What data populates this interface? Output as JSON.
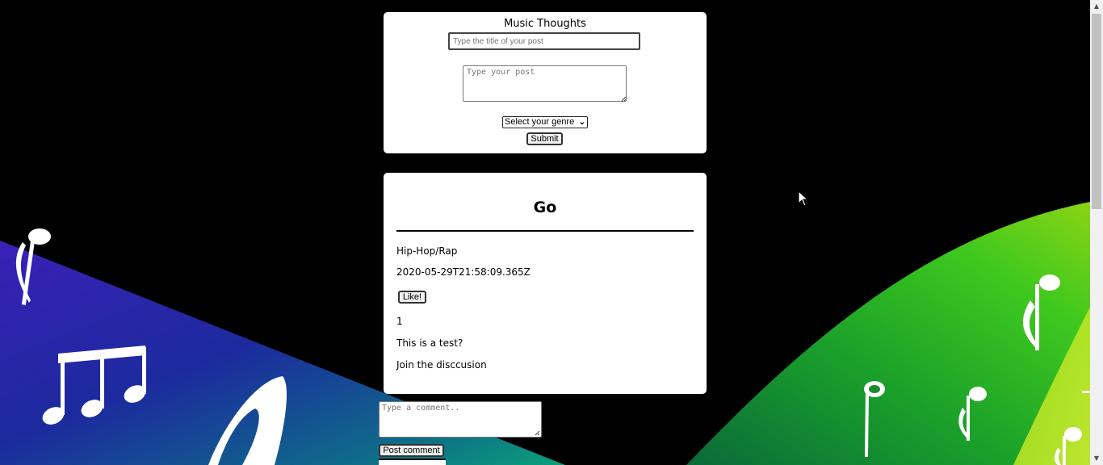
{
  "form": {
    "title": "Music Thoughts",
    "title_placeholder": "Type the title of your post",
    "post_placeholder": "Type your post",
    "genre_selected": "Select your genre",
    "submit_label": "Submit"
  },
  "post": {
    "title": "Go",
    "genre": "Hip-Hop/Rap",
    "timestamp": "2020-05-29T21:58:09.365Z",
    "like_label": "Like!",
    "like_count": "1",
    "body": "This is a test?",
    "discussion_label": "Join the disccusion"
  },
  "comment": {
    "placeholder": "Type a comment..",
    "post_label": "Post comment"
  },
  "colors": {
    "page_background": "#000000",
    "card_background": "#ffffff",
    "wave_left": "#2a1fa0",
    "wave_right": "#39c21c"
  },
  "icons": {
    "music_notes": "music-note-icon",
    "cursor": "mouse-pointer-icon",
    "scroll_up": "scroll-up-arrow-icon",
    "scroll_down": "scroll-down-arrow-icon",
    "select_chevron": "chevron-down-icon"
  }
}
